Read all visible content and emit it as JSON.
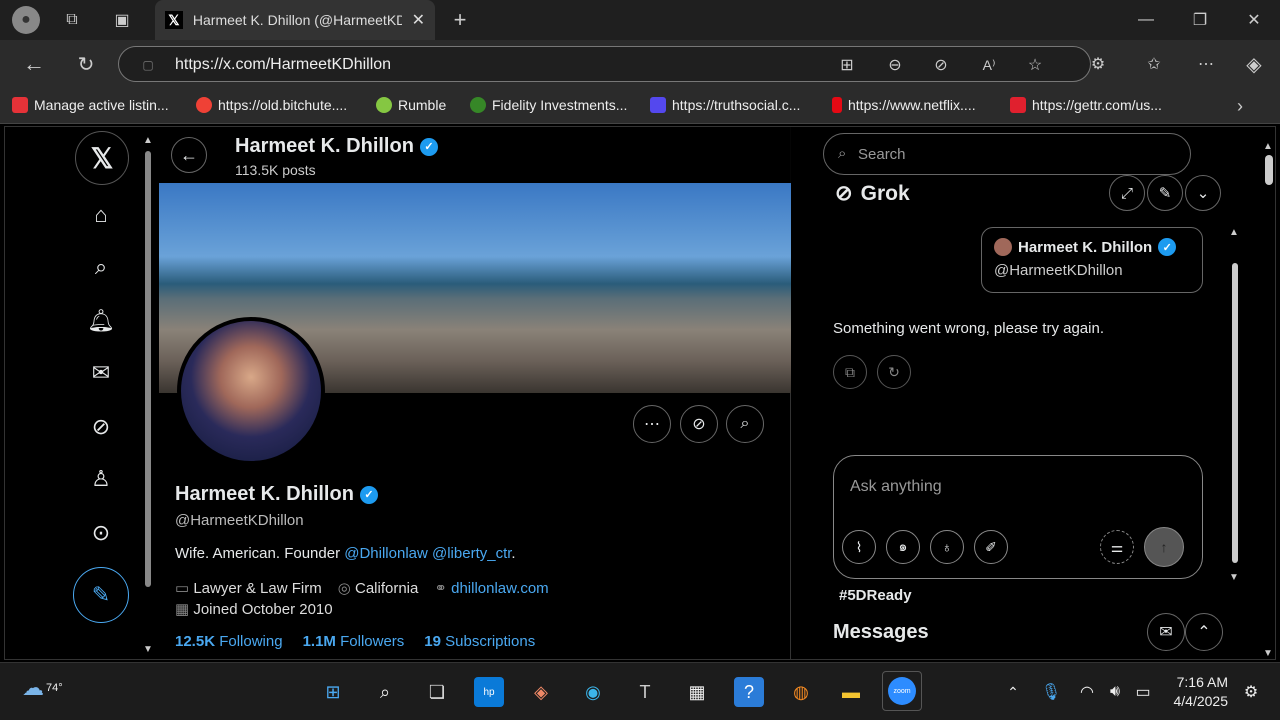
{
  "browser": {
    "tab_title": "Harmeet K. Dhillon (@HarmeetKD",
    "url": "https://x.com/HarmeetKDhillon",
    "bookmarks": [
      {
        "label": "Manage active listin...",
        "color": "#e53238"
      },
      {
        "label": "https://old.bitchute....",
        "color": "#ef4136"
      },
      {
        "label": "Rumble",
        "color": "#85c742"
      },
      {
        "label": "Fidelity Investments...",
        "color": "#368727"
      },
      {
        "label": "https://truthsocial.c...",
        "color": "#5448ee"
      },
      {
        "label": "https://www.netflix....",
        "color": "#e50914"
      },
      {
        "label": "https://gettr.com/us...",
        "color": "#e0202e"
      }
    ]
  },
  "header": {
    "name": "Harmeet K. Dhillon",
    "posts": "113.5K posts"
  },
  "profile": {
    "name": "Harmeet K. Dhillon",
    "handle": "@HarmeetKDhillon",
    "bio_prefix": "Wife. American. Founder ",
    "bio_link1": "@Dhillonlaw",
    "bio_link2": "@liberty_ctr",
    "bio_suffix": ".",
    "category": "Lawyer & Law Firm",
    "location": "California",
    "website": "dhillonlaw.com",
    "joined": "Joined October 2010",
    "following_count": "12.5K",
    "following_label": "Following",
    "followers_count": "1.1M",
    "followers_label": "Followers",
    "subs_count": "19",
    "subs_label": "Subscriptions"
  },
  "sidebar": {
    "search_placeholder": "Search",
    "grok_title": "Grok",
    "card_name": "Harmeet K. Dhillon",
    "card_handle": "@HarmeetKDhillon",
    "error_text": "Something went wrong, please try again.",
    "ask_placeholder": "Ask anything",
    "trend_text": "#5DReady",
    "messages_title": "Messages"
  },
  "taskbar": {
    "weather": "74°",
    "time": "7:16 AM",
    "date": "4/4/2025"
  }
}
